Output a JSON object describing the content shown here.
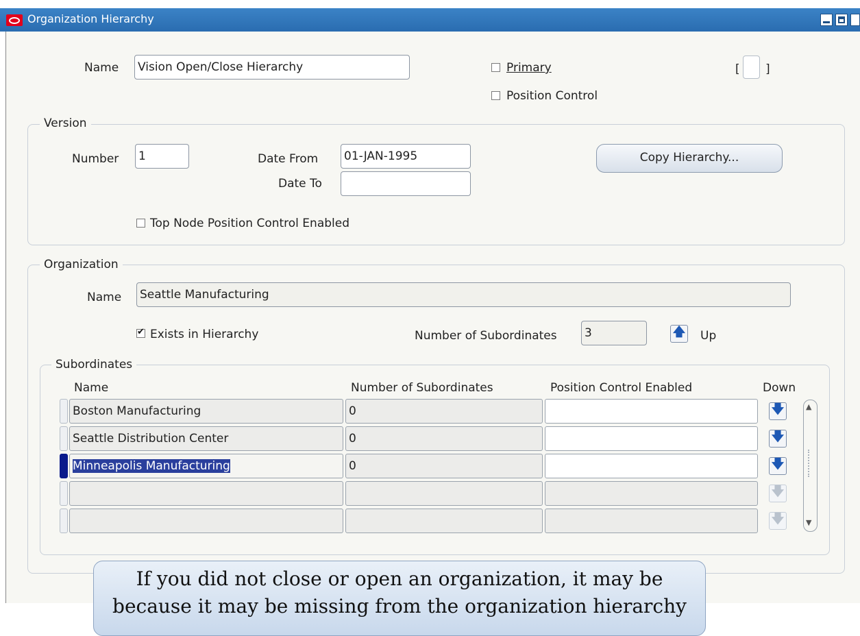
{
  "window": {
    "title": "Organization Hierarchy"
  },
  "header": {
    "name_label": "Name",
    "name_value": "Vision Open/Close Hierarchy",
    "primary_label": "Primary",
    "position_control_label": "Position Control",
    "bracket_open": "[",
    "bracket_close": "]"
  },
  "version": {
    "legend": "Version",
    "number_label": "Number",
    "number_value": "1",
    "date_from_label": "Date From",
    "date_from_value": "01-JAN-1995",
    "date_to_label": "Date To",
    "date_to_value": "",
    "copy_button": "Copy Hierarchy...",
    "top_node_label": "Top Node Position Control Enabled"
  },
  "organization": {
    "legend": "Organization",
    "name_label": "Name",
    "name_value": "Seattle Manufacturing",
    "exists_label": "Exists in Hierarchy",
    "exists_checked": true,
    "num_sub_label": "Number of Subordinates",
    "num_sub_value": "3",
    "up_label": "Up"
  },
  "subordinates": {
    "legend": "Subordinates",
    "columns": [
      "Name",
      "Number of Subordinates",
      "Position Control Enabled",
      "Down"
    ],
    "rows": [
      {
        "name": "Boston Manufacturing",
        "num": "0",
        "pos": ""
      },
      {
        "name": "Seattle Distribution Center",
        "num": "0",
        "pos": ""
      },
      {
        "name": "Minneapolis Manufacturing",
        "num": "0",
        "pos": ""
      },
      {
        "name": "",
        "num": "",
        "pos": ""
      },
      {
        "name": "",
        "num": "",
        "pos": ""
      }
    ]
  },
  "callout": {
    "line1": "If you did not close or open an organization, it may be",
    "line2": "because it may be missing from the organization hierarchy"
  },
  "colors": {
    "titlebar": "#2f74b9",
    "selection": "#2a3f9d",
    "brand": "#e3001b"
  },
  "icons": [
    "oracle-logo-icon",
    "minimize-icon",
    "maximize-icon",
    "up-arrow-icon",
    "down-arrow-icon",
    "scroll-up-icon",
    "scroll-down-icon"
  ]
}
